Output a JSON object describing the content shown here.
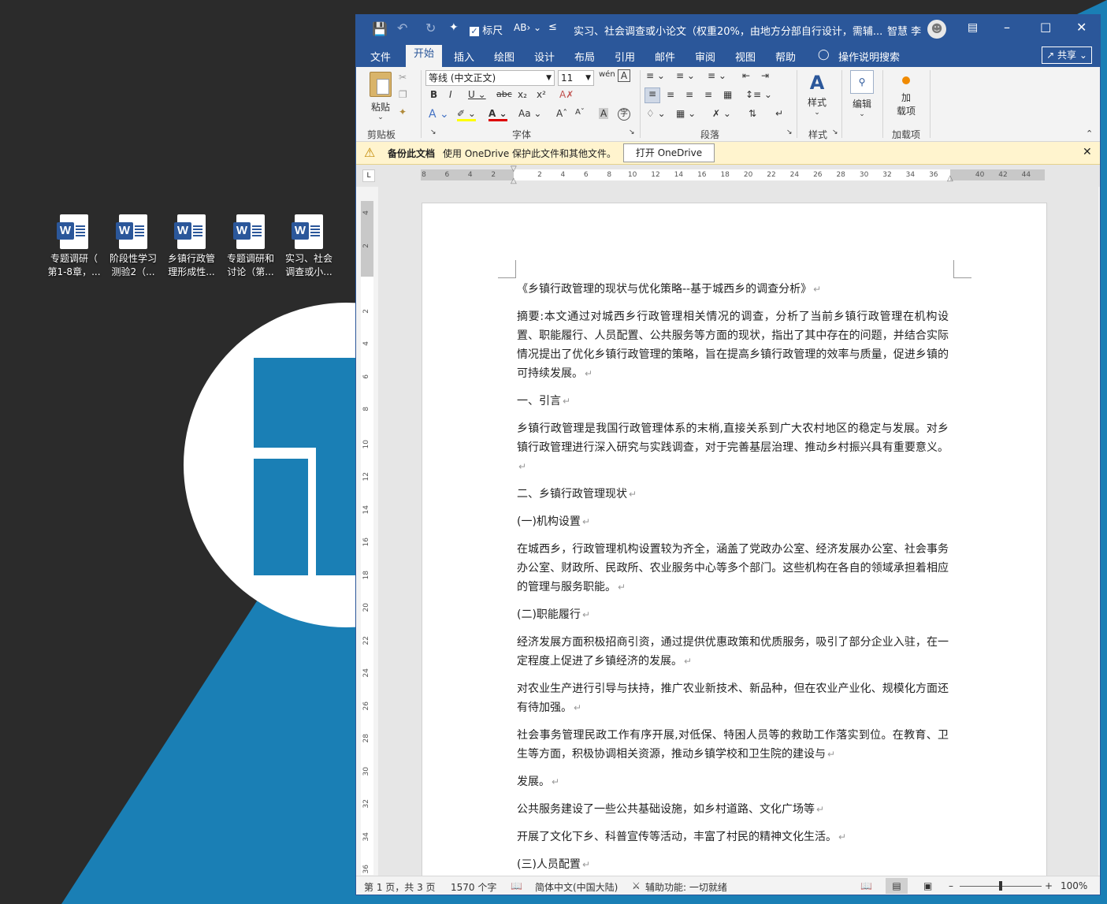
{
  "desktop": {
    "icons": [
      {
        "line1": "专题调研（",
        "line2": "第1-8章，..."
      },
      {
        "line1": "阶段性学习",
        "line2": "测验2（..."
      },
      {
        "line1": "乡镇行政管",
        "line2": "理形成性..."
      },
      {
        "line1": "专题调研和",
        "line2": "讨论（第..."
      },
      {
        "line1": "实习、社会",
        "line2": "调查或小..."
      }
    ]
  },
  "titlebar": {
    "ruler_label": "标尺",
    "title": "实习、社会调查或小论文（权重20%，由地方分部自行设计，需辅...",
    "user": "智慧 李"
  },
  "tabs": [
    "文件",
    "开始",
    "插入",
    "绘图",
    "设计",
    "布局",
    "引用",
    "邮件",
    "审阅",
    "视图",
    "帮助"
  ],
  "tell_me": "操作说明搜索",
  "share": "共享",
  "ribbon": {
    "paste": "粘贴",
    "clipboard": "剪贴板",
    "font_name": "等线 (中文正文)",
    "font_size": "11",
    "font_group": "字体",
    "paragraph_group": "段落",
    "styles": "样式",
    "styles_group": "样式",
    "edit": "编辑",
    "addin": "加\n载项",
    "addin_line1": "加",
    "addin_line2": "载项",
    "addin_group": "加载项"
  },
  "infobar": {
    "title": "备份此文档",
    "message": "使用 OneDrive 保护此文件和其他文件。",
    "button": "打开 OneDrive"
  },
  "hruler_ticks": [
    "8",
    "6",
    "4",
    "2",
    "",
    "2",
    "4",
    "6",
    "8",
    "10",
    "12",
    "14",
    "16",
    "18",
    "20",
    "22",
    "24",
    "26",
    "28",
    "30",
    "32",
    "34",
    "36",
    "",
    "40",
    "42",
    "44"
  ],
  "vruler_ticks": [
    "4",
    "2",
    "",
    "2",
    "4",
    "6",
    "8",
    "10",
    "12",
    "14",
    "16",
    "18",
    "20",
    "22",
    "24",
    "26",
    "28",
    "30",
    "32",
    "34",
    "36"
  ],
  "document": {
    "paragraphs": [
      "《乡镇行政管理的现状与优化策略--基于城西乡的调查分析》",
      "摘要:本文通过对城西乡行政管理相关情况的调查，分析了当前乡镇行政管理在机构设置、职能履行、人员配置、公共服务等方面的现状，指出了其中存在的问题，并结合实际情况提出了优化乡镇行政管理的策略，旨在提高乡镇行政管理的效率与质量，促进乡镇的可持续发展。",
      "一、引言",
      "乡镇行政管理是我国行政管理体系的末梢,直接关系到广大农村地区的稳定与发展。对乡镇行政管理进行深入研究与实践调查，对于完善基层治理、推动乡村振兴具有重要意义。",
      "二、乡镇行政管理现状",
      "(一)机构设置",
      "在城西乡，行政管理机构设置较为齐全，涵盖了党政办公室、经济发展办公室、社会事务办公室、财政所、民政所、农业服务中心等多个部门。这些机构在各自的领域承担着相应的管理与服务职能。",
      "(二)职能履行",
      "经济发展方面积极招商引资，通过提供优惠政策和优质服务，吸引了部分企业入驻，在一定程度上促进了乡镇经济的发展。",
      "对农业生产进行引导与扶持，推广农业新技术、新品种，但在农业产业化、规模化方面还有待加强。",
      "社会事务管理民政工作有序开展,对低保、特困人员等的救助工作落实到位。在教育、卫生等方面，积极协调相关资源，推动乡镇学校和卫生院的建设与",
      "发展。",
      "公共服务建设了一些公共基础设施，如乡村道路、文化广场等",
      "开展了文化下乡、科普宣传等活动，丰富了村民的精神文化生活。",
      "(三)人员配置"
    ]
  },
  "statusbar": {
    "page": "第 1 页，共 3 页",
    "words": "1570 个字",
    "language": "简体中文(中国大陆)",
    "accessibility": "辅助功能: 一切就绪",
    "zoom": "100%"
  },
  "colors": {
    "word_blue": "#2b579a",
    "desktop_blue": "#1a7fb5",
    "desktop_dark": "#2b2b2b",
    "infobar": "#fff4ce"
  }
}
